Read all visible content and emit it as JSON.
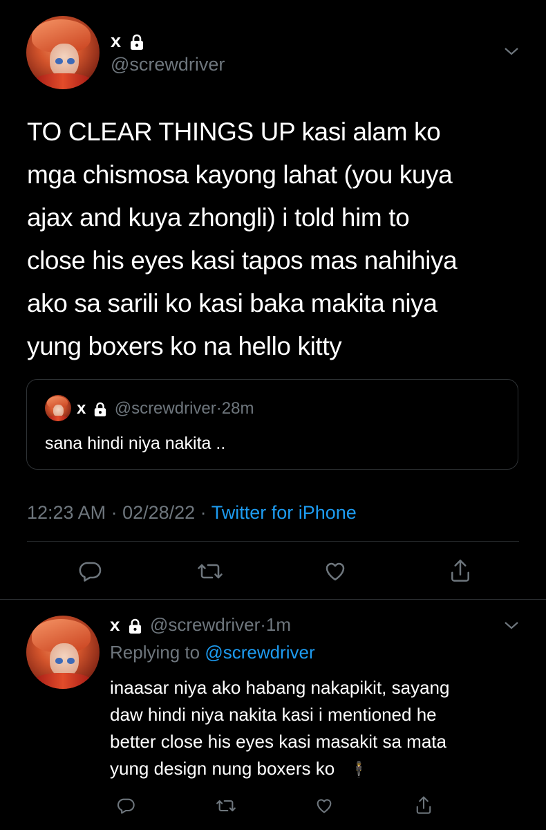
{
  "tweet": {
    "author_name": "x",
    "handle": "@screwdriver",
    "text_lines": [
      "TO CLEAR THINGS UP kasi alam ko",
      "mga chismosa kayong lahat (you kuya",
      "ajax and kuya zhongli) i told him to",
      "close his eyes kasi tapos mas nahihiya",
      "ako sa sarili ko kasi baka makita niya",
      "yung boxers ko na hello kitty"
    ],
    "quote": {
      "author_name": "x",
      "handle": "@screwdriver",
      "dot": "·",
      "time": "28m",
      "text": "sana hindi niya nakita .."
    },
    "timestamp": "12:23 AM · 02/28/22 · ",
    "source": "Twitter for iPhone"
  },
  "reply": {
    "author_name": "x",
    "handle": "@screwdriver",
    "dot": "·",
    "time": "1m",
    "replying_prefix": "Replying to ",
    "replying_handle": "@screwdriver",
    "text_lines": [
      "inaasar niya ako habang nakapikit, sayang",
      "daw hindi niya nakita kasi i mentioned he",
      "better close his eyes kasi masakit sa mata",
      "yung design nung boxers ko"
    ],
    "emoji": "🕴"
  },
  "icons": {
    "lock": "lock-icon",
    "chevron": "chevron-down-icon",
    "reply": "reply-icon",
    "retweet": "retweet-icon",
    "like": "like-icon",
    "share": "share-icon"
  }
}
